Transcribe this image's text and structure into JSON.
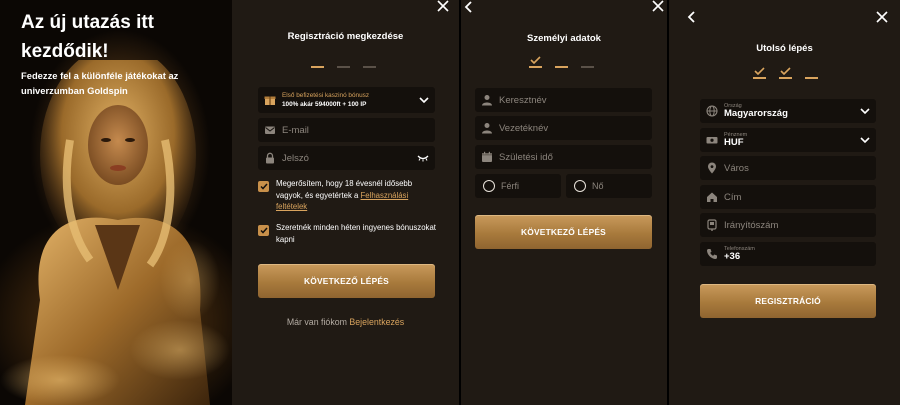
{
  "hero": {
    "title": "Az új utazás itt kezdődik!",
    "subtitle": "Fedezze fel a különféle játékokat az univerzumban Goldspin"
  },
  "step1": {
    "title": "Regisztráció megkezdése",
    "progress": {
      "total": 3,
      "completed": 0,
      "current": 1
    },
    "bonus": {
      "label": "Első befizetési kaszinó bónusz",
      "value": "100% akár 594000ft + 100 IP"
    },
    "email_placeholder": "E-mail",
    "password_placeholder": "Jelszó",
    "consent_age": {
      "checked": true,
      "text": "Megerősítem, hogy 18 évesnél idősebb vagyok, és egyetértek a ",
      "link": "Felhasználási feltételek"
    },
    "consent_bonus": {
      "checked": true,
      "text": "Szeretnék minden héten ingyenes bónuszokat kapni"
    },
    "next_button": "KÖVETKEZŐ LÉPÉS",
    "login_prompt": "Már van fiókom",
    "login_link": "Bejelentkezés"
  },
  "step2": {
    "title": "Személyi adatok",
    "progress": {
      "total": 3,
      "completed": 1,
      "current": 2
    },
    "first_name_placeholder": "Keresztnév",
    "last_name_placeholder": "Vezetéknév",
    "birthdate_placeholder": "Születési idő",
    "gender_male": "Férfi",
    "gender_female": "Nő",
    "next_button": "KÖVETKEZŐ LÉPÉS"
  },
  "step3": {
    "title": "Utolsó lépés",
    "progress": {
      "total": 3,
      "completed": 2,
      "current": 3
    },
    "country": {
      "label": "Ország",
      "value": "Magyarország"
    },
    "currency": {
      "label": "Pénznem",
      "value": "HUF"
    },
    "city_placeholder": "Város",
    "address_placeholder": "Cím",
    "zip_placeholder": "Irányítószám",
    "phone": {
      "label": "Telefonszám",
      "value": "+36"
    },
    "register_button": "REGISZTRÁCIÓ"
  },
  "colors": {
    "accent": "#d9a45e",
    "panel_bg": "#201a14",
    "field_bg": "#14100c",
    "muted_text": "#8c857d"
  }
}
